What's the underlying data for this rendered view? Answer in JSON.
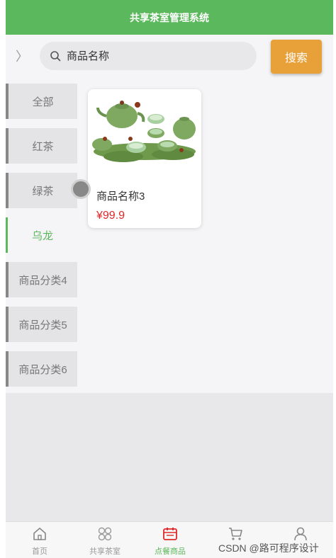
{
  "header": {
    "title": "共享茶室管理系统"
  },
  "search": {
    "placeholder": "商品名称",
    "button_label": "搜索"
  },
  "categories": [
    {
      "label": "全部"
    },
    {
      "label": "红茶"
    },
    {
      "label": "绿茶"
    },
    {
      "label": "乌龙",
      "active": true
    },
    {
      "label": "商品分类4"
    },
    {
      "label": "商品分类5"
    },
    {
      "label": "商品分类6"
    }
  ],
  "products": [
    {
      "name": "商品名称3",
      "price": "¥99.9",
      "image": "green-tea-set"
    }
  ],
  "tabbar": {
    "items": [
      {
        "label": "首页",
        "icon": "home-icon"
      },
      {
        "label": "共享茶室",
        "icon": "grid-icon"
      },
      {
        "label": "点餐商品",
        "icon": "calendar-icon",
        "active": true
      },
      {
        "label": "",
        "icon": "cart-icon"
      },
      {
        "label": "",
        "icon": "user-icon"
      }
    ]
  },
  "watermark": "CSDN @路可程序设计",
  "colors": {
    "brand": "#5cb85c",
    "search_button": "#e8a038",
    "price": "#e0282a"
  }
}
